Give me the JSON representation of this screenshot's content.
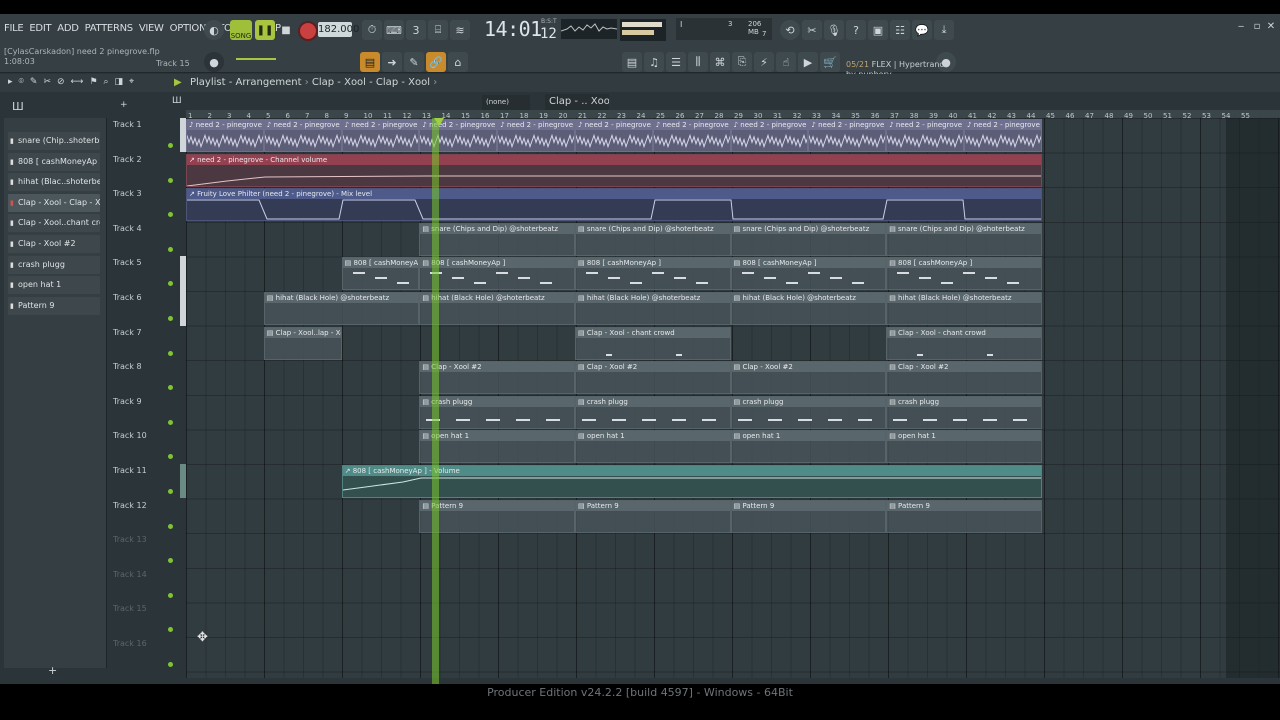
{
  "menu": [
    "FILE",
    "EDIT",
    "ADD",
    "PATTERNS",
    "VIEW",
    "OPTIONS",
    "TOOLS",
    "HELP"
  ],
  "transport": {
    "song_label": "SONG",
    "tempo": "182.000",
    "time": "14:01",
    "time_sub": "12",
    "time_sub_label": "B:S:T"
  },
  "memory": {
    "mb": "206 MB",
    "polyphony": "3",
    "voices": "7"
  },
  "project": {
    "user": "[CylasCarskadon]",
    "file": "need 2 pinegrove.flp",
    "position": "1:08:03",
    "track_hint": "Track 15"
  },
  "hint_panel": {
    "counter": "05/21",
    "line1": "FLEX | Hypertrance",
    "line2": "by nuphory"
  },
  "pattern_selector": {
    "value": "(none)",
    "pattern": "Clap - .. Xool"
  },
  "playlist": {
    "title": "Playlist - Arrangement",
    "breadcrumb": "Clap - Xool - Clap - Xool"
  },
  "picker": [
    {
      "label": "snare (Chip..shoterbeatz"
    },
    {
      "label": "808 [ cashMoneyAp ]"
    },
    {
      "label": "hihat (Blac..shoterbeatz"
    },
    {
      "label": "Clap - Xool - Clap - Xool"
    },
    {
      "label": "Clap - Xool..chant crowd"
    },
    {
      "label": "Clap - Xool #2"
    },
    {
      "label": "crash plugg"
    },
    {
      "label": "open hat 1"
    },
    {
      "label": "Pattern 9"
    }
  ],
  "ruler": [
    "1",
    "2",
    "3",
    "4",
    "5",
    "6",
    "7",
    "8",
    "9",
    "10",
    "11",
    "12",
    "13",
    "14",
    "15",
    "16",
    "17",
    "18",
    "19",
    "20",
    "21",
    "22",
    "23",
    "24",
    "25",
    "26",
    "27",
    "28",
    "29",
    "30",
    "31",
    "32",
    "33",
    "34",
    "35",
    "36",
    "37",
    "38",
    "39",
    "40",
    "41",
    "42",
    "43",
    "44",
    "45",
    "46",
    "47",
    "48",
    "49",
    "50",
    "51",
    "52",
    "53",
    "54",
    "55"
  ],
  "tracks": [
    "Track 1",
    "Track 2",
    "Track 3",
    "Track 4",
    "Track 5",
    "Track 6",
    "Track 7",
    "Track 8",
    "Track 9",
    "Track 10",
    "Track 11",
    "Track 12",
    "Track 13",
    "Track 14",
    "Track 15",
    "Track 16"
  ],
  "clips": {
    "audio": "need 2 - pinegrove",
    "channel_volume": "need 2 - pinegrove - Channel volume",
    "mix_level": "Fruity Love Philter (need 2 - pinegrove) - Mix level",
    "snare": "snare (Chips and Dip) @shoterbeatz",
    "bass": "808 [ cashMoneyAp ]",
    "hihat": "hihat (Black Hole) @shoterbeatz",
    "clap_short": "Clap - Xool..lap - Xool",
    "clap_chant": "Clap - Xool - chant crowd",
    "clap2": "Clap - Xool #2",
    "crash": "crash plugg",
    "openhat": "open hat 1",
    "volume": "808 [ cashMoneyAp ] - Volume",
    "pattern9": "Pattern 9"
  },
  "footer": "Producer Edition v24.2.2 [build 4597] - Windows - 64Bit",
  "colors": {
    "accent": "#a9c43e",
    "audio_clip": "#6f7090",
    "auto_red": "#934150",
    "auto_blue": "#4d5a8a",
    "auto_teal": "#4f8b87"
  }
}
